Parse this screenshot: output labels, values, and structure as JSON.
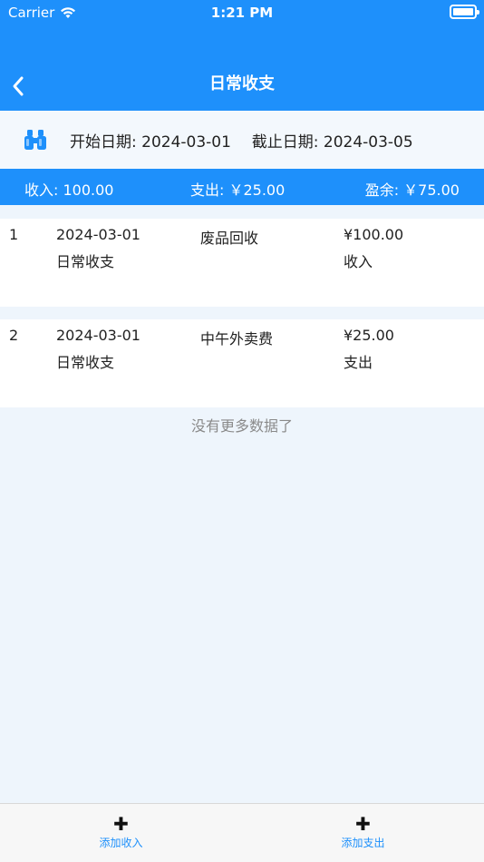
{
  "status_bar": {
    "carrier": "Carrier",
    "time": "1:21 PM"
  },
  "nav": {
    "title": "日常收支",
    "back_icon": "chevron-left-icon"
  },
  "date_range": {
    "icon": "binoculars-icon",
    "start_label": "开始日期:",
    "start_date": "2024-03-01",
    "end_label": "截止日期:",
    "end_date": "2024-03-05"
  },
  "summary": {
    "income": "收入: 100.00",
    "expense": "支出: ￥25.00",
    "balance": "盈余: ￥75.00"
  },
  "records": [
    {
      "index": "1",
      "date": "2024-03-01",
      "category": "日常收支",
      "name": "废品回收",
      "amount": "¥100.00",
      "type": "收入"
    },
    {
      "index": "2",
      "date": "2024-03-01",
      "category": "日常收支",
      "name": "中午外卖费",
      "amount": "¥25.00",
      "type": "支出"
    }
  ],
  "no_more_text": "没有更多数据了",
  "tabbar": {
    "add_income_label": "添加收入",
    "add_expense_label": "添加支出",
    "plus_icon": "plus-icon"
  },
  "colors": {
    "primary": "#1e90fb",
    "background": "#eef5fc"
  }
}
